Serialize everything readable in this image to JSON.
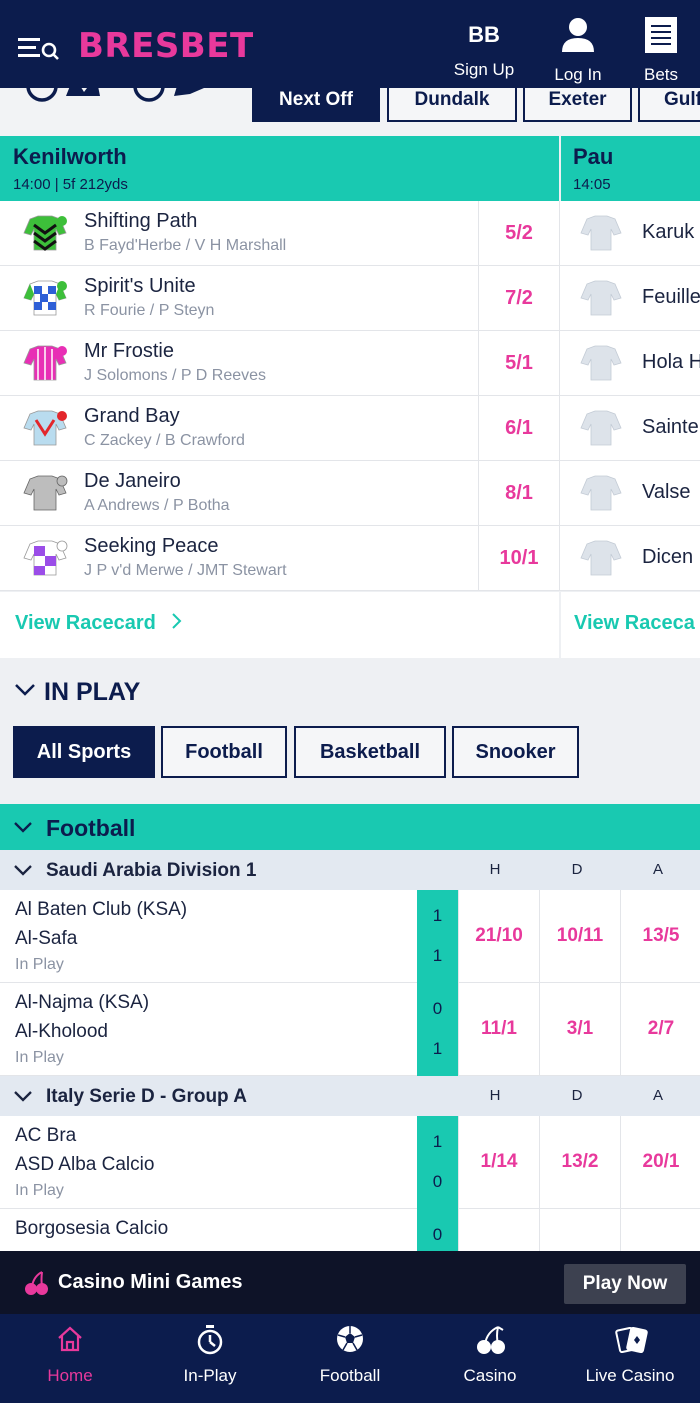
{
  "header": {
    "logo": "BRESBET",
    "signup_initials": "BB",
    "signup_label": "Sign Up",
    "login_label": "Log In",
    "bets_label": "Bets"
  },
  "race_tabs": [
    {
      "label": "Next Off"
    },
    {
      "label": "Dundalk"
    },
    {
      "label": "Exeter"
    },
    {
      "label": "Gulf"
    }
  ],
  "races": [
    {
      "course": "Kenilworth",
      "info": "14:00 | 5f 212yds",
      "runners": [
        {
          "name": "Shifting Path",
          "connections": "B Fayd'Herbe / V H Marshall",
          "odds": "5/2"
        },
        {
          "name": "Spirit's Unite",
          "connections": "R Fourie / P Steyn",
          "odds": "7/2"
        },
        {
          "name": "Mr Frostie",
          "connections": "J Solomons / P D Reeves",
          "odds": "5/1"
        },
        {
          "name": "Grand Bay",
          "connections": "C Zackey / B Crawford",
          "odds": "6/1"
        },
        {
          "name": "De Janeiro",
          "connections": "A Andrews / P Botha",
          "odds": "8/1"
        },
        {
          "name": "Seeking Peace",
          "connections": "J P v'd Merwe / JMT Stewart",
          "odds": "10/1"
        }
      ],
      "view_label": "View Racecard"
    },
    {
      "course": "Pau",
      "info": "14:05",
      "runners": [
        {
          "name": "Karuk"
        },
        {
          "name": "Feuille"
        },
        {
          "name": "Hola H"
        },
        {
          "name": "Sainte"
        },
        {
          "name": "Valse"
        },
        {
          "name": "Dicen"
        }
      ],
      "view_label": "View Raceca"
    }
  ],
  "inplay": {
    "title": "IN PLAY",
    "filters": [
      "All Sports",
      "Football",
      "Basketball",
      "Snooker"
    ]
  },
  "sport_section": "Football",
  "competitions": [
    {
      "name": "Saudi Arabia Division 1",
      "cols": [
        "H",
        "D",
        "A"
      ],
      "events": [
        {
          "home": "Al Baten Club (KSA)",
          "away": "Al-Safa",
          "status": "In Play",
          "score_home": "1",
          "score_away": "1",
          "odds": [
            "21/10",
            "10/11",
            "13/5"
          ]
        },
        {
          "home": "Al-Najma (KSA)",
          "away": "Al-Kholood",
          "status": "In Play",
          "score_home": "0",
          "score_away": "1",
          "odds": [
            "11/1",
            "3/1",
            "2/7"
          ]
        }
      ]
    },
    {
      "name": "Italy Serie D - Group A",
      "cols": [
        "H",
        "D",
        "A"
      ],
      "events": [
        {
          "home": "AC Bra",
          "away": "ASD Alba Calcio",
          "status": "In Play",
          "score_home": "1",
          "score_away": "0",
          "odds": [
            "1/14",
            "13/2",
            "20/1"
          ]
        },
        {
          "home": "Borgosesia Calcio",
          "away": "",
          "status": "",
          "score_home": "0",
          "score_away": "",
          "odds": [
            "",
            "",
            ""
          ]
        }
      ]
    }
  ],
  "banner": {
    "title": "Casino Mini Games",
    "button": "Play Now"
  },
  "bottom_nav": [
    {
      "label": "Home"
    },
    {
      "label": "In-Play"
    },
    {
      "label": "Football"
    },
    {
      "label": "Casino"
    },
    {
      "label": "Live Casino"
    }
  ],
  "colors": {
    "navy": "#0c1c4d",
    "teal": "#19c9b1",
    "pink": "#e8399c"
  }
}
